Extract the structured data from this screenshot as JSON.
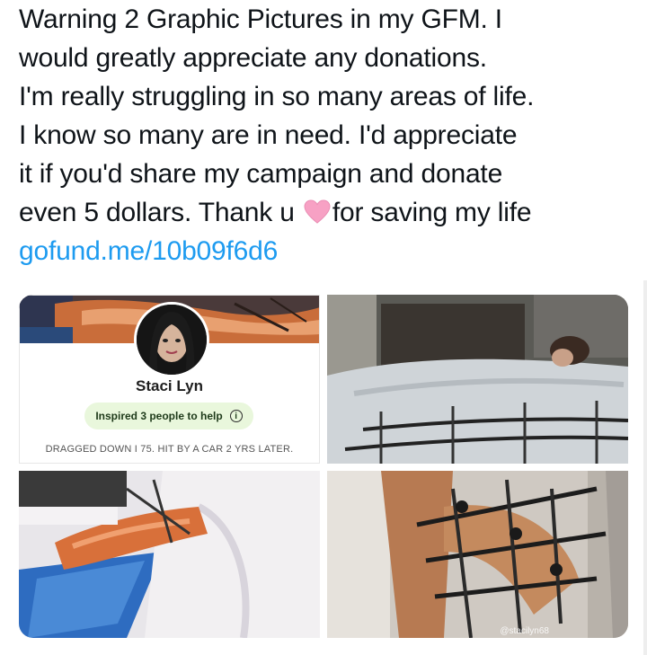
{
  "tweet": {
    "lines": [
      "Warning 2 Graphic Pictures in my GFM. I",
      "would greatly appreciate any donations.",
      "I'm really struggling in so many areas of life.",
      "I know so many are in need. I'd appreciate",
      "it if you'd share my campaign and donate",
      "even 5 dollars. Thank u"
    ],
    "line6_after_emoji": "for saving my life",
    "emoji": "pink-heart-icon",
    "link": "gofund.me/10b09f6d6"
  },
  "media": {
    "card": {
      "name": "Staci Lyn",
      "inspired": "Inspired 3 people to help",
      "caption": "DRAGGED DOWN I 75. HIT BY A CAR 2 YRS LATER."
    },
    "watermark": "@stacilyn68"
  },
  "colors": {
    "link": "#1d9bf0",
    "text": "#0f1419",
    "heart": "#f7a1c4",
    "pill": "#e9f7dc"
  }
}
